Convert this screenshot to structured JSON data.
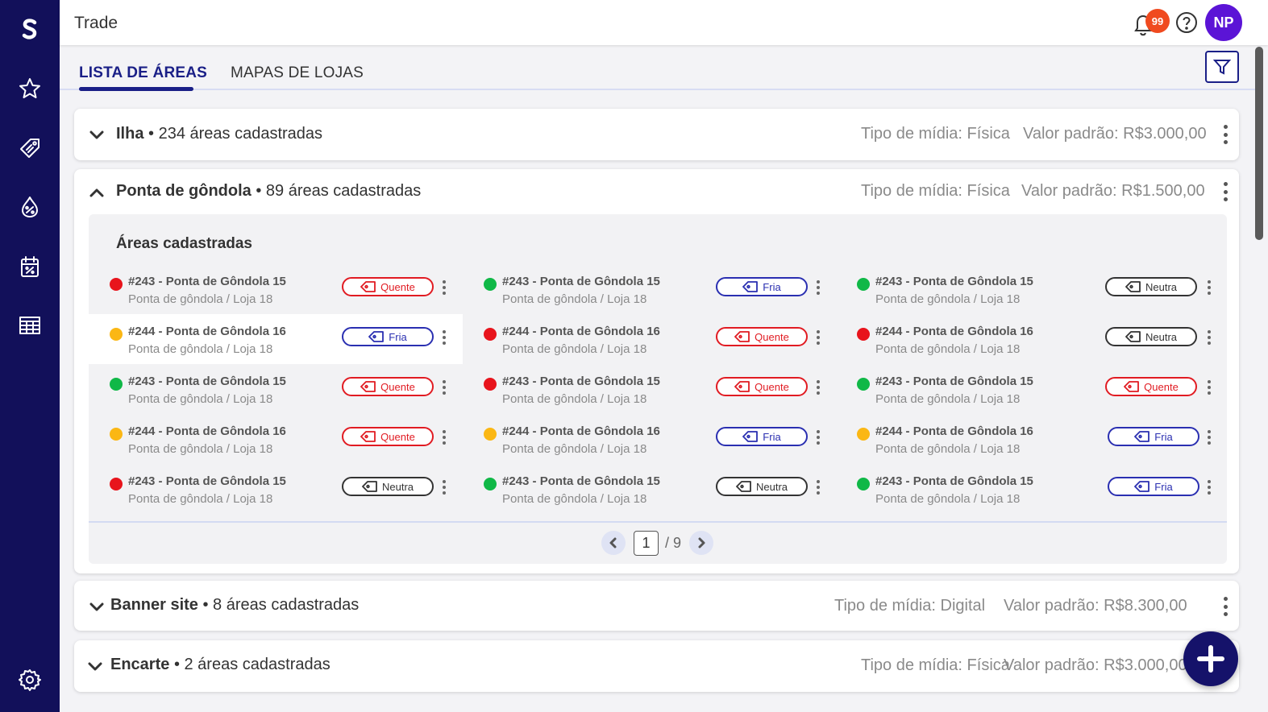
{
  "app": {
    "title": "Trade"
  },
  "header": {
    "notification_count": "99",
    "avatar_initials": "NP"
  },
  "tabs": [
    {
      "label": "LISTA DE ÁREAS",
      "active": true
    },
    {
      "label": "MAPAS DE LOJAS",
      "active": false
    }
  ],
  "groups": [
    {
      "name": "Ilha",
      "count": "• 234 áreas cadastradas",
      "media": "Tipo de mídia: Física",
      "value": "Valor padrão: R$3.000,00",
      "expanded": false
    },
    {
      "name": "Ponta de gôndola",
      "count": "• 89 áreas cadastradas",
      "media": "Tipo de mídia: Física",
      "value": "Valor padrão: R$1.500,00",
      "expanded": true
    },
    {
      "name": "Banner site",
      "count": "• 8 áreas cadastradas",
      "media": "Tipo de mídia: Digital",
      "value": "Valor padrão: R$8.300,00",
      "expanded": false
    },
    {
      "name": "Encarte",
      "count": "• 2 áreas cadastradas",
      "media": "Tipo de mídia: Física",
      "value": "Valor padrão: R$3.000,00",
      "expanded": false
    }
  ],
  "areas_panel": {
    "title": "Áreas cadastradas",
    "columns": [
      [
        {
          "name": "#243 - Ponta de Gôndola 15",
          "sub": "Ponta de gôndola / Loja 18",
          "status": "red",
          "tag": "Quente",
          "tag_type": "quente"
        },
        {
          "name": "#244 - Ponta de Gôndola 16",
          "sub": "Ponta de gôndola / Loja 18",
          "status": "yellow",
          "tag": "Fria",
          "tag_type": "fria"
        },
        {
          "name": "#243 - Ponta de Gôndola 15",
          "sub": "Ponta de gôndola / Loja 18",
          "status": "green",
          "tag": "Quente",
          "tag_type": "quente"
        },
        {
          "name": "#244 - Ponta de Gôndola 16",
          "sub": "Ponta de gôndola / Loja 18",
          "status": "yellow",
          "tag": "Quente",
          "tag_type": "quente"
        },
        {
          "name": "#243 - Ponta de Gôndola 15",
          "sub": "Ponta de gôndola / Loja 18",
          "status": "red",
          "tag": "Neutra",
          "tag_type": "neutra"
        }
      ],
      [
        {
          "name": "#243 - Ponta de Gôndola 15",
          "sub": "Ponta de gôndola / Loja 18",
          "status": "green",
          "tag": "Fria",
          "tag_type": "fria"
        },
        {
          "name": "#244 - Ponta de Gôndola 16",
          "sub": "Ponta de gôndola / Loja 18",
          "status": "red",
          "tag": "Quente",
          "tag_type": "quente"
        },
        {
          "name": "#243 - Ponta de Gôndola 15",
          "sub": "Ponta de gôndola / Loja 18",
          "status": "red",
          "tag": "Quente",
          "tag_type": "quente"
        },
        {
          "name": "#244 - Ponta de Gôndola 16",
          "sub": "Ponta de gôndola / Loja 18",
          "status": "yellow",
          "tag": "Fria",
          "tag_type": "fria"
        },
        {
          "name": "#243 - Ponta de Gôndola 15",
          "sub": "Ponta de gôndola / Loja 18",
          "status": "green",
          "tag": "Neutra",
          "tag_type": "neutra"
        }
      ],
      [
        {
          "name": "#243 - Ponta de Gôndola 15",
          "sub": "Ponta de gôndola / Loja 18",
          "status": "green",
          "tag": "Neutra",
          "tag_type": "neutra"
        },
        {
          "name": "#244 - Ponta de Gôndola 16",
          "sub": "Ponta de gôndola / Loja 18",
          "status": "red",
          "tag": "Neutra",
          "tag_type": "neutra"
        },
        {
          "name": "#243 - Ponta de Gôndola 15",
          "sub": "Ponta de gôndola / Loja 18",
          "status": "green",
          "tag": "Quente",
          "tag_type": "quente"
        },
        {
          "name": "#244 - Ponta de Gôndola 16",
          "sub": "Ponta de gôndola / Loja 18",
          "status": "yellow",
          "tag": "Fria",
          "tag_type": "fria"
        },
        {
          "name": "#243 - Ponta de Gôndola 15",
          "sub": "Ponta de gôndola / Loja 18",
          "status": "green",
          "tag": "Fria",
          "tag_type": "fria"
        }
      ]
    ]
  },
  "pagination": {
    "current": "1",
    "total": "/ 9"
  },
  "status_colors": {
    "red": "#e8141c",
    "yellow": "#fbb714",
    "green": "#10b847"
  },
  "colors": {
    "sidebar": "#12105a",
    "accent": "#1a1f87",
    "badge": "#f04a1f",
    "avatar": "#5b14d6"
  },
  "icons": {
    "sidebar": [
      "brand-logo-icon",
      "star-icon",
      "tag-icon",
      "percent-drop-icon",
      "calendar-percent-icon",
      "table-icon",
      "settings-icon"
    ]
  }
}
